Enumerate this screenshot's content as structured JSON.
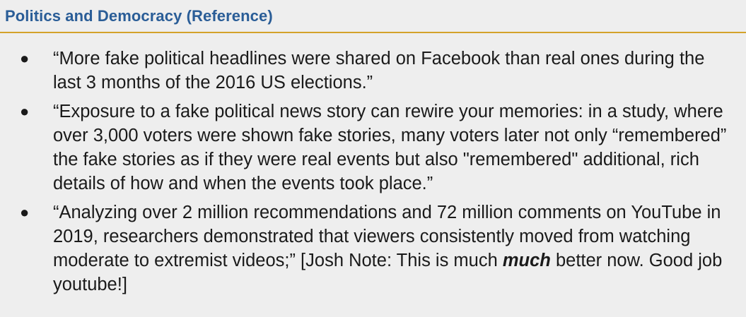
{
  "slide": {
    "title": "Politics and Democracy (Reference)",
    "bullet_marker": "●",
    "bullets": [
      {
        "text": "“More fake political headlines were shared on Facebook than real ones during the last 3 months of the 2016 US elections.”"
      },
      {
        "text": "“Exposure to a fake political news story can rewire your memories: in a study, where over 3,000 voters were shown fake stories, many voters later not only “remembered” the fake stories as if they were real events but also \"remembered\" additional, rich details of how and when the events took place.”"
      },
      {
        "text_before": "“Analyzing over 2 million recommendations and 72 million comments on YouTube in 2019, researchers demonstrated that viewers consistently moved from watching moderate to extremist videos;” [Josh Note: This is much ",
        "emphasis": "much",
        "text_after": " better now. Good job youtube!]"
      }
    ]
  },
  "colors": {
    "title": "#2a5d97",
    "rule": "#d4a22a",
    "background": "#eeeeee",
    "text": "#1a1a1a"
  }
}
